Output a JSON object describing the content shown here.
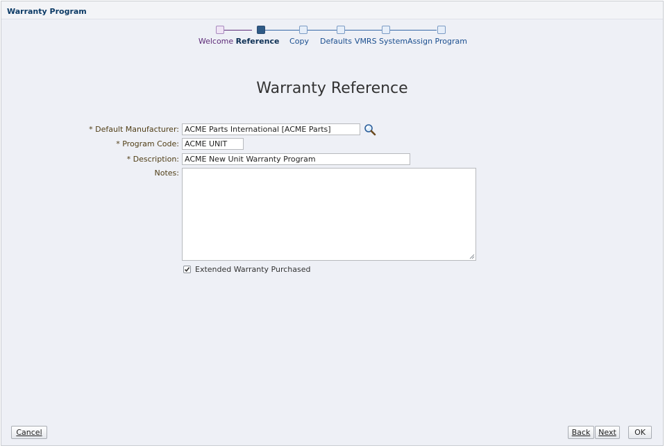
{
  "window": {
    "title": "Warranty Program"
  },
  "train": {
    "stops": [
      {
        "label": "Welcome",
        "state": "visited"
      },
      {
        "label": "Reference",
        "state": "current"
      },
      {
        "label": "Copy",
        "state": "unvisited"
      },
      {
        "label": "Defaults",
        "state": "unvisited"
      },
      {
        "label": "VMRS System",
        "state": "unvisited"
      },
      {
        "label": "Assign Program",
        "state": "unvisited"
      }
    ]
  },
  "page": {
    "title": "Warranty Reference"
  },
  "form": {
    "required_mark": "*",
    "default_manufacturer": {
      "label": "Default Manufacturer:",
      "value": "ACME Parts International [ACME Parts]",
      "required": true
    },
    "program_code": {
      "label": "Program Code:",
      "value": "ACME UNIT",
      "required": true
    },
    "description": {
      "label": "Description:",
      "value": "ACME New Unit Warranty Program",
      "required": true
    },
    "notes": {
      "label": "Notes:",
      "value": ""
    },
    "extended_warranty": {
      "label": "Extended Warranty Purchased",
      "checked": true
    }
  },
  "footer": {
    "cancel_label": "Cancel",
    "back_label": "Back",
    "next_label": "Next",
    "ok_label": "OK"
  },
  "colors": {
    "visited": "#5c2a78",
    "current": "#0d2f54",
    "unvisited": "#1a4e8f",
    "label": "#4f3d15",
    "panel_bg": "#eef0f6"
  },
  "icons": {
    "search": "magnifier-icon",
    "check": "checkmark-icon"
  }
}
